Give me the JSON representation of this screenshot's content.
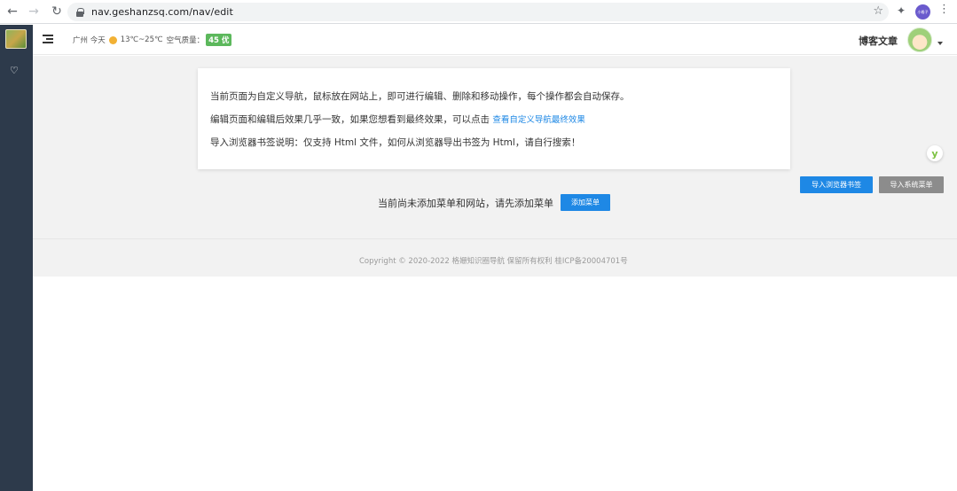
{
  "browser": {
    "url": "nav.geshanzsq.com/nav/edit",
    "profile_label": "小格子"
  },
  "header": {
    "weather_city_day": "广州 今天",
    "temperature": "13℃~25℃",
    "air_quality_label": "空气质量：",
    "aqi_badge": "45 优",
    "blog_link": "博客文章"
  },
  "notice": {
    "line1": "当前页面为自定义导航，鼠标放在网站上，即可进行编辑、删除和移动操作，每个操作都会自动保存。",
    "line2_prefix": "编辑页面和编辑后效果几乎一致，如果您想看到最终效果，可以点击",
    "line2_link": "查看自定义导航最终效果",
    "line3": "导入浏览器书签说明：仅支持 Html 文件，如何从浏览器导出书签为 Html，请自行搜索！"
  },
  "actions": {
    "import_bookmarks": "导入浏览器书签",
    "import_system_menu": "导入系统菜单",
    "add_menu": "添加菜单"
  },
  "empty_state": "当前尚未添加菜单和网站，请先添加菜单",
  "footer": {
    "copyright": "Copyright © 2020-2022 格姗知识圈导航 保留所有权利 桂ICP备20004701号"
  },
  "colors": {
    "sidebar_bg": "#2d3a4b",
    "primary_blue": "#1e88e5",
    "secondary_gray": "#8c8c8c",
    "aqi_green": "#5cb85c"
  }
}
